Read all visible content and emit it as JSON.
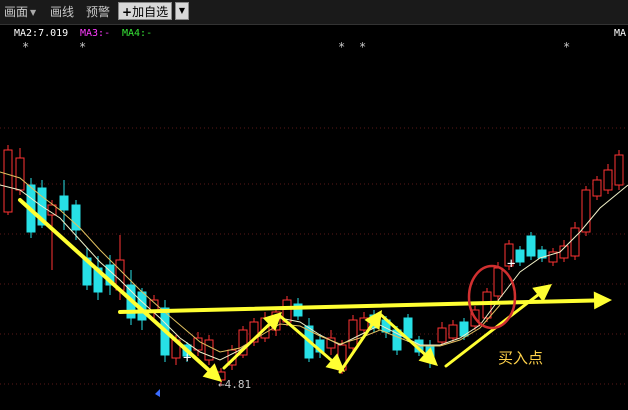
{
  "toolbar": {
    "draw_label": "画面",
    "line_label": "画线",
    "alert_label": "预警",
    "add_label": "加自选",
    "add_icon": "plus-icon",
    "dropdown_icon": "chevron-down-icon"
  },
  "indicators": {
    "ma2": "MA2:7.019",
    "ma3": "MA3:-",
    "ma4": "MA4:-",
    "ma_right": "MA",
    "star": "*",
    "colors": {
      "ma2": "#ffffff",
      "ma3": "#ff3cff",
      "ma4": "#37e637"
    }
  },
  "annotations": {
    "low_price": "4.81",
    "buy_point": "买入点",
    "low_marker": "←"
  },
  "colors": {
    "up": "#ff3333",
    "down": "#27e0e6",
    "arrow": "#ffff32",
    "circle": "#d03030",
    "ma_line": "#f0f0c8",
    "ma_line2": "#e0c060"
  }
}
